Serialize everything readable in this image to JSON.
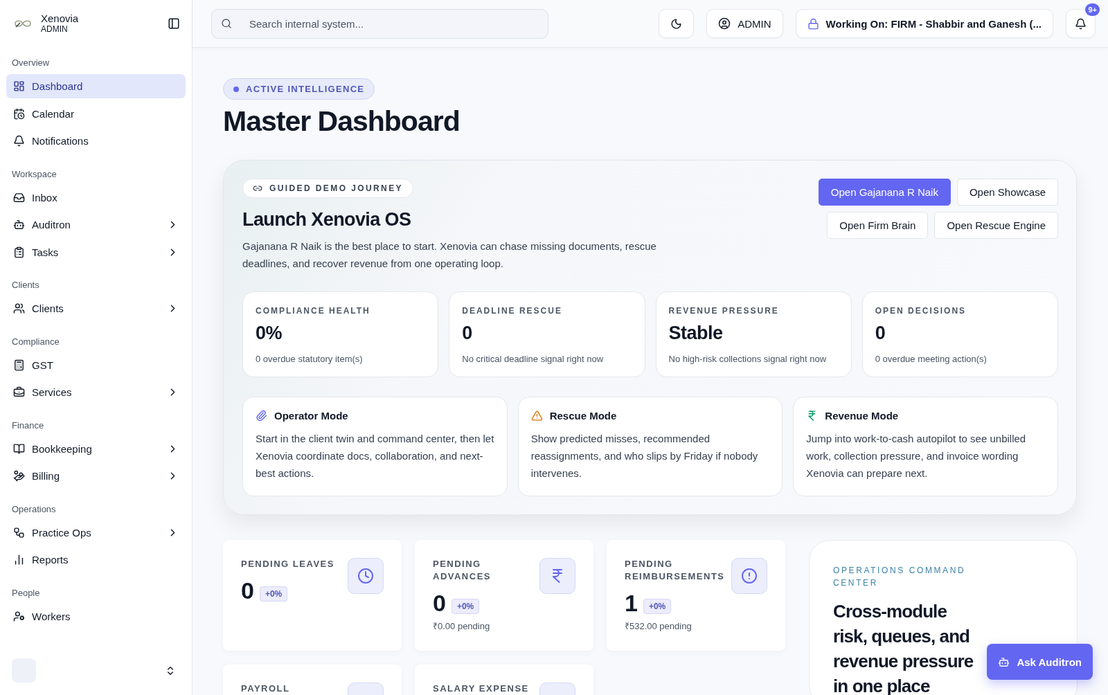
{
  "sidebar": {
    "brand": {
      "name": "Xenovia",
      "role": "ADMIN"
    },
    "sections": [
      {
        "title": "Overview",
        "items": [
          {
            "label": "Dashboard",
            "selected": true,
            "expandable": false
          },
          {
            "label": "Calendar",
            "selected": false,
            "expandable": false
          },
          {
            "label": "Notifications",
            "selected": false,
            "expandable": false
          }
        ]
      },
      {
        "title": "Workspace",
        "items": [
          {
            "label": "Inbox",
            "selected": false,
            "expandable": false
          },
          {
            "label": "Auditron",
            "selected": false,
            "expandable": true
          },
          {
            "label": "Tasks",
            "selected": false,
            "expandable": true
          }
        ]
      },
      {
        "title": "Clients",
        "items": [
          {
            "label": "Clients",
            "selected": false,
            "expandable": true
          }
        ]
      },
      {
        "title": "Compliance",
        "items": [
          {
            "label": "GST",
            "selected": false,
            "expandable": false
          },
          {
            "label": "Services",
            "selected": false,
            "expandable": true
          }
        ]
      },
      {
        "title": "Finance",
        "items": [
          {
            "label": "Bookkeeping",
            "selected": false,
            "expandable": true
          },
          {
            "label": "Billing",
            "selected": false,
            "expandable": true
          }
        ]
      },
      {
        "title": "Operations",
        "items": [
          {
            "label": "Practice Ops",
            "selected": false,
            "expandable": true
          },
          {
            "label": "Reports",
            "selected": false,
            "expandable": false
          }
        ]
      },
      {
        "title": "People",
        "items": [
          {
            "label": "Workers",
            "selected": false,
            "expandable": false
          }
        ]
      }
    ]
  },
  "header": {
    "search": {
      "placeholder": "Search internal system..."
    },
    "user": "ADMIN",
    "working_on": "Working On: FIRM - Shabbir and Ganesh (...",
    "notification_badge": "9+"
  },
  "page": {
    "badge": "ACTIVE INTELLIGENCE",
    "title": "Master Dashboard"
  },
  "journey": {
    "tag": "GUIDED DEMO JOURNEY",
    "title": "Launch Xenovia OS",
    "description": "Gajanana R Naik is the best place to start. Xenovia can chase missing documents, rescue deadlines, and recover revenue from one operating loop.",
    "buttons": [
      {
        "label": "Open Gajanana R Naik",
        "primary": true
      },
      {
        "label": "Open Showcase",
        "primary": false
      },
      {
        "label": "Open Firm Brain",
        "primary": false
      },
      {
        "label": "Open Rescue Engine",
        "primary": false
      }
    ],
    "metrics": [
      {
        "label": "COMPLIANCE HEALTH",
        "value": "0%",
        "note": "0 overdue statutory item(s)"
      },
      {
        "label": "DEADLINE RESCUE",
        "value": "0",
        "note": "No critical deadline signal right now"
      },
      {
        "label": "REVENUE PRESSURE",
        "value": "Stable",
        "note": "No high-risk collections signal right now"
      },
      {
        "label": "OPEN DECISIONS",
        "value": "0",
        "note": "0 overdue meeting action(s)"
      }
    ],
    "modes": [
      {
        "kind": "operator",
        "title": "Operator Mode",
        "description": "Start in the client twin and command center, then let Xenovia coordinate docs, collaboration, and next-best actions."
      },
      {
        "kind": "rescue",
        "title": "Rescue Mode",
        "description": "Show predicted misses, recommended reassignments, and who slips by Friday if nobody intervenes."
      },
      {
        "kind": "revenue",
        "title": "Revenue Mode",
        "description": "Jump into work-to-cash autopilot to see unbilled work, collection pressure, and invoice wording Xenovia can prepare next."
      }
    ]
  },
  "stats": [
    {
      "label": "PENDING LEAVES",
      "value": "0",
      "delta": "+0%"
    },
    {
      "label": "PENDING ADVANCES",
      "value": "0",
      "delta": "+0%",
      "note": "₹0.00 pending"
    },
    {
      "label": "PENDING REIMBURSEMENTS",
      "value": "1",
      "delta": "+0%",
      "note": "₹532.00 pending"
    },
    {
      "label": "PAYROLL"
    },
    {
      "label": "SALARY EXPENSE"
    }
  ],
  "operations": {
    "eyebrow": "OPERATIONS COMMAND CENTER",
    "heading": "Cross-module risk, queues, and revenue pressure in one place"
  },
  "assistant_button": "Ask Auditron"
}
